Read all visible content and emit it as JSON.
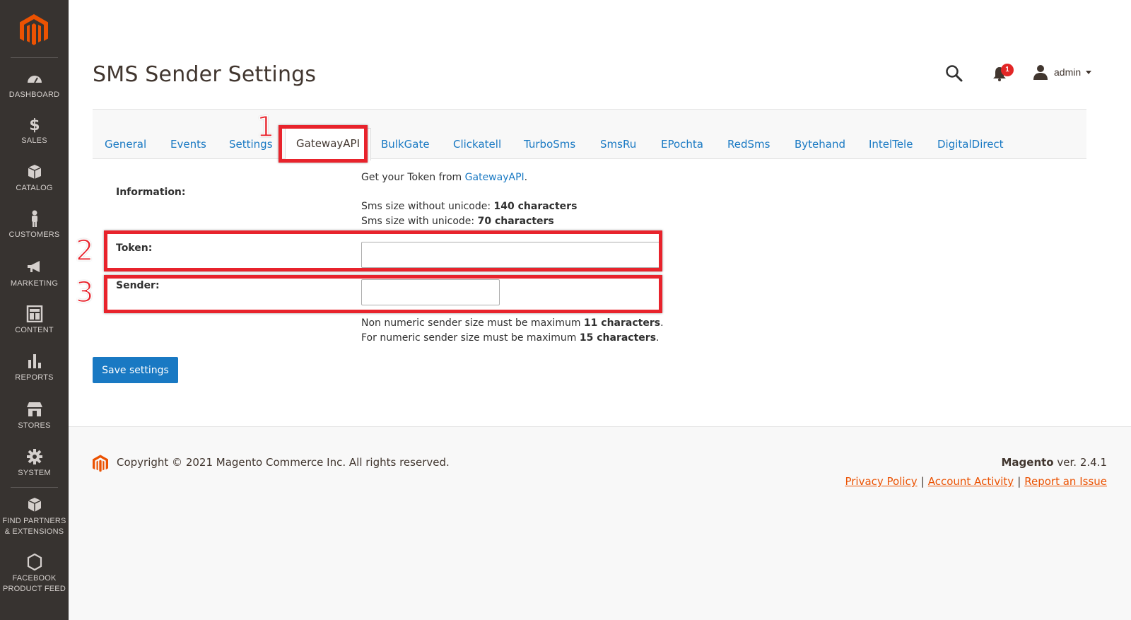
{
  "sidebar": {
    "items": [
      {
        "label": "DASHBOARD",
        "icon": "dashboard-icon"
      },
      {
        "label": "SALES",
        "icon": "dollar-icon"
      },
      {
        "label": "CATALOG",
        "icon": "box-icon"
      },
      {
        "label": "CUSTOMERS",
        "icon": "person-icon"
      },
      {
        "label": "MARKETING",
        "icon": "megaphone-icon"
      },
      {
        "label": "CONTENT",
        "icon": "layout-icon"
      },
      {
        "label": "REPORTS",
        "icon": "bar-chart-icon"
      },
      {
        "label": "STORES",
        "icon": "store-icon"
      },
      {
        "label": "SYSTEM",
        "icon": "gear-icon"
      },
      {
        "label_line1": "FIND PARTNERS",
        "label_line2": "& EXTENSIONS",
        "icon": "cubes-icon"
      },
      {
        "label_line1": "FACEBOOK",
        "label_line2": "PRODUCT FEED",
        "icon": "hexagon-icon"
      }
    ]
  },
  "header": {
    "title": "SMS Sender Settings",
    "notification_count": "1",
    "admin_name": "admin"
  },
  "tabs": [
    {
      "label": "General"
    },
    {
      "label": "Events"
    },
    {
      "label": "Settings"
    },
    {
      "label": "GatewayAPI",
      "active": true
    },
    {
      "label": "BulkGate"
    },
    {
      "label": "Clickatell"
    },
    {
      "label": "TurboSms"
    },
    {
      "label": "SmsRu"
    },
    {
      "label": "EPochta"
    },
    {
      "label": "RedSms"
    },
    {
      "label": "Bytehand"
    },
    {
      "label": "IntelTele"
    },
    {
      "label": "DigitalDirect"
    }
  ],
  "form": {
    "information_label": "Information:",
    "token_info_prefix": "Get your Token from ",
    "token_info_link": "GatewayAPI",
    "token_info_suffix": ".",
    "sms_no_unicode_prefix": "Sms size without unicode: ",
    "sms_no_unicode_value": "140 characters",
    "sms_unicode_prefix": "Sms size with unicode: ",
    "sms_unicode_value": "70 characters",
    "token_label": "Token:",
    "token_value": "",
    "sender_label": "Sender:",
    "sender_value": "",
    "sender_note1_prefix": "Non numeric sender size must be maximum ",
    "sender_note1_value": "11 characters",
    "sender_note1_suffix": ".",
    "sender_note2_prefix": "For numeric sender size must be maximum ",
    "sender_note2_value": "15 characters",
    "sender_note2_suffix": ".",
    "save_label": "Save settings"
  },
  "annotations": {
    "n1": "1",
    "n2": "2",
    "n3": "3"
  },
  "footer": {
    "copyright": "Copyright © 2021 Magento Commerce Inc. All rights reserved.",
    "brand": "Magento",
    "version": " ver. 2.4.1",
    "links": [
      "Privacy Policy",
      "Account Activity",
      "Report an Issue"
    ]
  },
  "colors": {
    "sidebar_bg": "#373330",
    "brand_orange": "#eb5202",
    "link_blue": "#1979c3",
    "annotation_red": "#e8232c"
  }
}
